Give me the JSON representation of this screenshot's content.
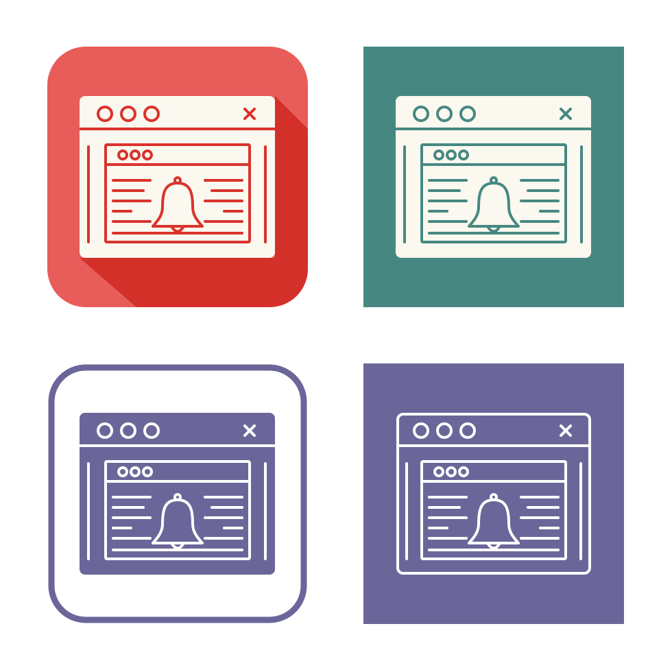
{
  "icons": [
    {
      "variant": "flat-shadow",
      "icon": "browser-notification-bell-icon",
      "background": "#e85c5a",
      "shadow": "#d3302a",
      "window": "#fbf8ef",
      "line": "#d9332b"
    },
    {
      "variant": "filled-square",
      "icon": "browser-notification-bell-icon",
      "background": "#468881",
      "window": "#fbf8ef",
      "line": "#468881"
    },
    {
      "variant": "outline-rounded",
      "icon": "browser-notification-bell-icon",
      "background": "#ffffff",
      "border": "#6b6699",
      "window": "#6b6699",
      "line": "#ffffff"
    },
    {
      "variant": "line-on-square",
      "icon": "browser-notification-bell-icon",
      "background": "#6b6699",
      "line": "#ffffff"
    }
  ]
}
